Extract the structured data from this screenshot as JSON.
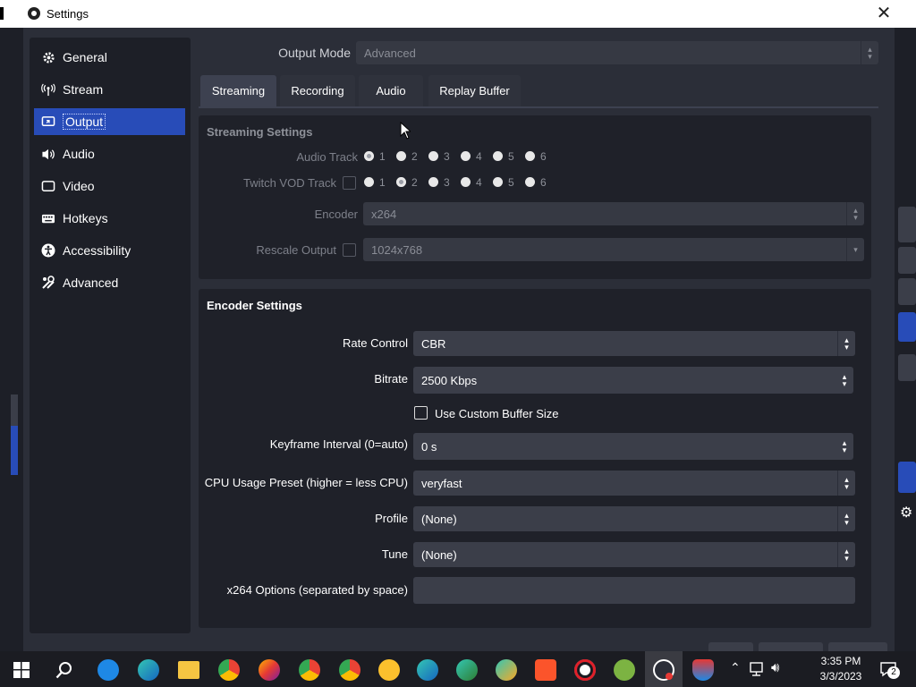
{
  "window": {
    "title": "Settings",
    "close_glyph": "✕"
  },
  "sidebar": {
    "items": [
      {
        "label": "General",
        "icon": "gear-icon"
      },
      {
        "label": "Stream",
        "icon": "broadcast-icon"
      },
      {
        "label": "Output",
        "icon": "output-icon"
      },
      {
        "label": "Audio",
        "icon": "speaker-icon"
      },
      {
        "label": "Video",
        "icon": "monitor-icon"
      },
      {
        "label": "Hotkeys",
        "icon": "keyboard-icon"
      },
      {
        "label": "Accessibility",
        "icon": "accessibility-icon"
      },
      {
        "label": "Advanced",
        "icon": "tools-icon"
      }
    ],
    "selected": "Output"
  },
  "output_mode": {
    "label": "Output Mode",
    "value": "Advanced"
  },
  "tabs": [
    {
      "label": "Streaming"
    },
    {
      "label": "Recording"
    },
    {
      "label": "Audio"
    },
    {
      "label": "Replay Buffer"
    }
  ],
  "active_tab": "Streaming",
  "streaming_settings": {
    "title": "Streaming Settings",
    "audio_track_label": "Audio Track",
    "twitch_vod_label": "Twitch VOD Track",
    "track_numbers": [
      "1",
      "2",
      "3",
      "4",
      "5",
      "6"
    ],
    "audio_track_selected": "1",
    "twitch_vod_selected": "1",
    "encoder_label": "Encoder",
    "encoder_value": "x264",
    "rescale_label": "Rescale Output",
    "rescale_value": "1024x768"
  },
  "encoder_settings": {
    "title": "Encoder Settings",
    "rate_control_label": "Rate Control",
    "rate_control_value": "CBR",
    "bitrate_label": "Bitrate",
    "bitrate_value": "2500 Kbps",
    "custom_buffer_label": "Use Custom Buffer Size",
    "keyframe_label": "Keyframe Interval (0=auto)",
    "keyframe_value": "0 s",
    "cpu_preset_label": "CPU Usage Preset (higher = less CPU)",
    "cpu_preset_value": "veryfast",
    "profile_label": "Profile",
    "profile_value": "(None)",
    "tune_label": "Tune",
    "tune_value": "(None)",
    "x264_options_label": "x264 Options (separated by space)",
    "x264_options_value": ""
  },
  "taskbar": {
    "time": "3:35 PM",
    "date": "3/3/2023",
    "notification_count": "2"
  },
  "colors": {
    "accent": "#284cb8",
    "panel": "#1f2129",
    "background": "#2b2e38"
  }
}
